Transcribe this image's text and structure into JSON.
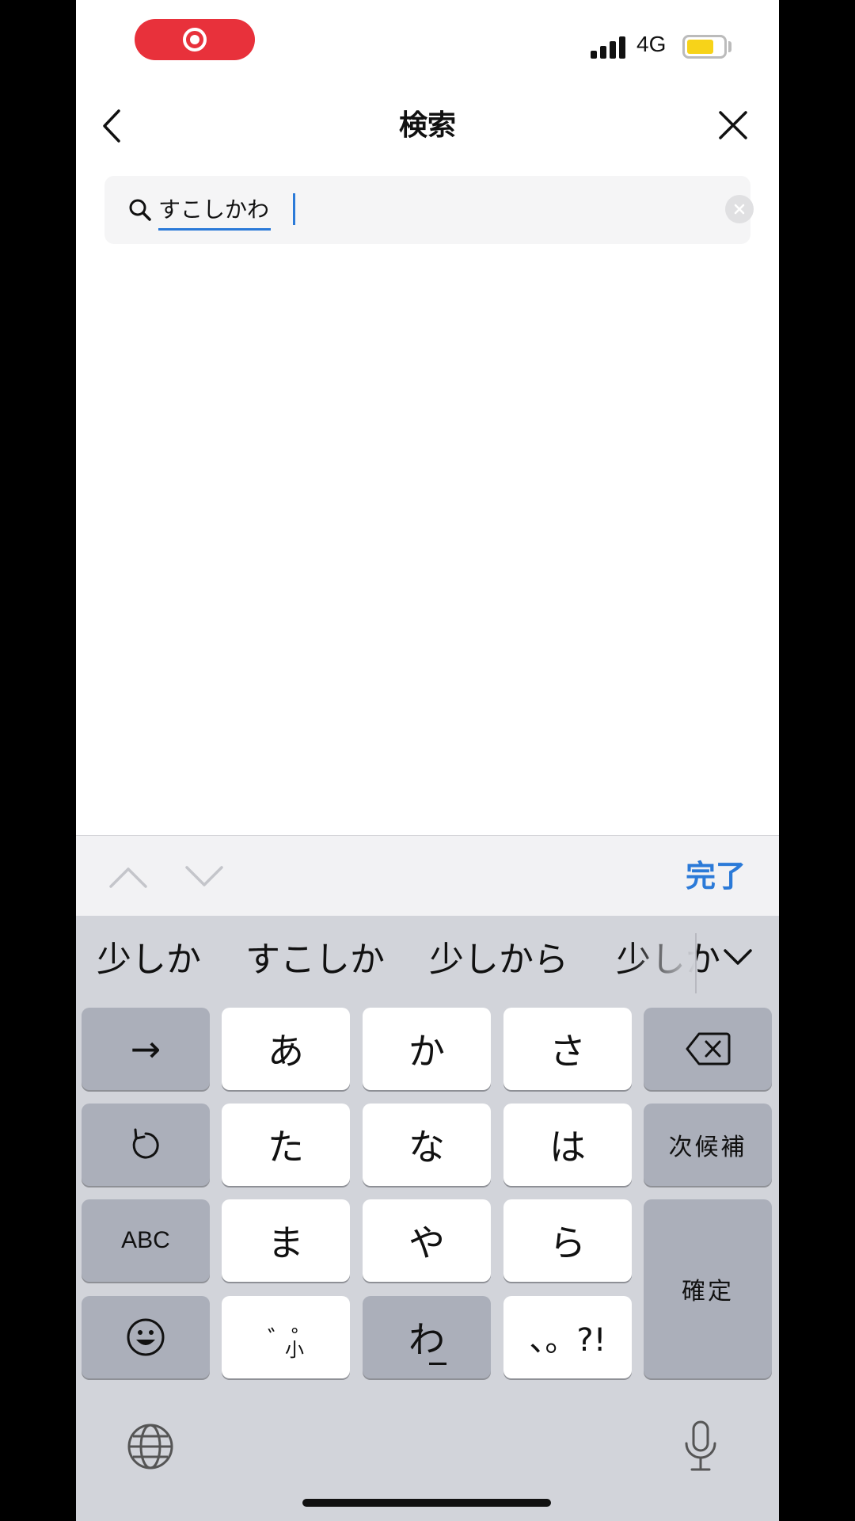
{
  "status_bar": {
    "network": "4G",
    "battery_color": "#f7d319",
    "record_color": "#e8313b"
  },
  "header": {
    "title": "検索",
    "back_icon": "chevron-left-icon",
    "close_icon": "close-icon"
  },
  "search": {
    "value": "すこしかわ",
    "clear_icon": "clear-circle-icon"
  },
  "accessory_bar": {
    "done_label": "完了",
    "done_color": "#2b7ad8"
  },
  "keyboard": {
    "candidates": [
      "少しか",
      "すこしか",
      "少しから",
      "少しか"
    ],
    "keys": {
      "arrow": "→",
      "a": "あ",
      "ka": "か",
      "sa": "さ",
      "ta": "た",
      "na": "な",
      "ha": "は",
      "next_candidate": "次候補",
      "abc": "ABC",
      "ma": "ま",
      "ya": "や",
      "ra": "ら",
      "confirm": "確定",
      "dakuten": "゛゜",
      "dakuten_small": "小",
      "wa": "わ",
      "punct": "、。?!"
    }
  }
}
